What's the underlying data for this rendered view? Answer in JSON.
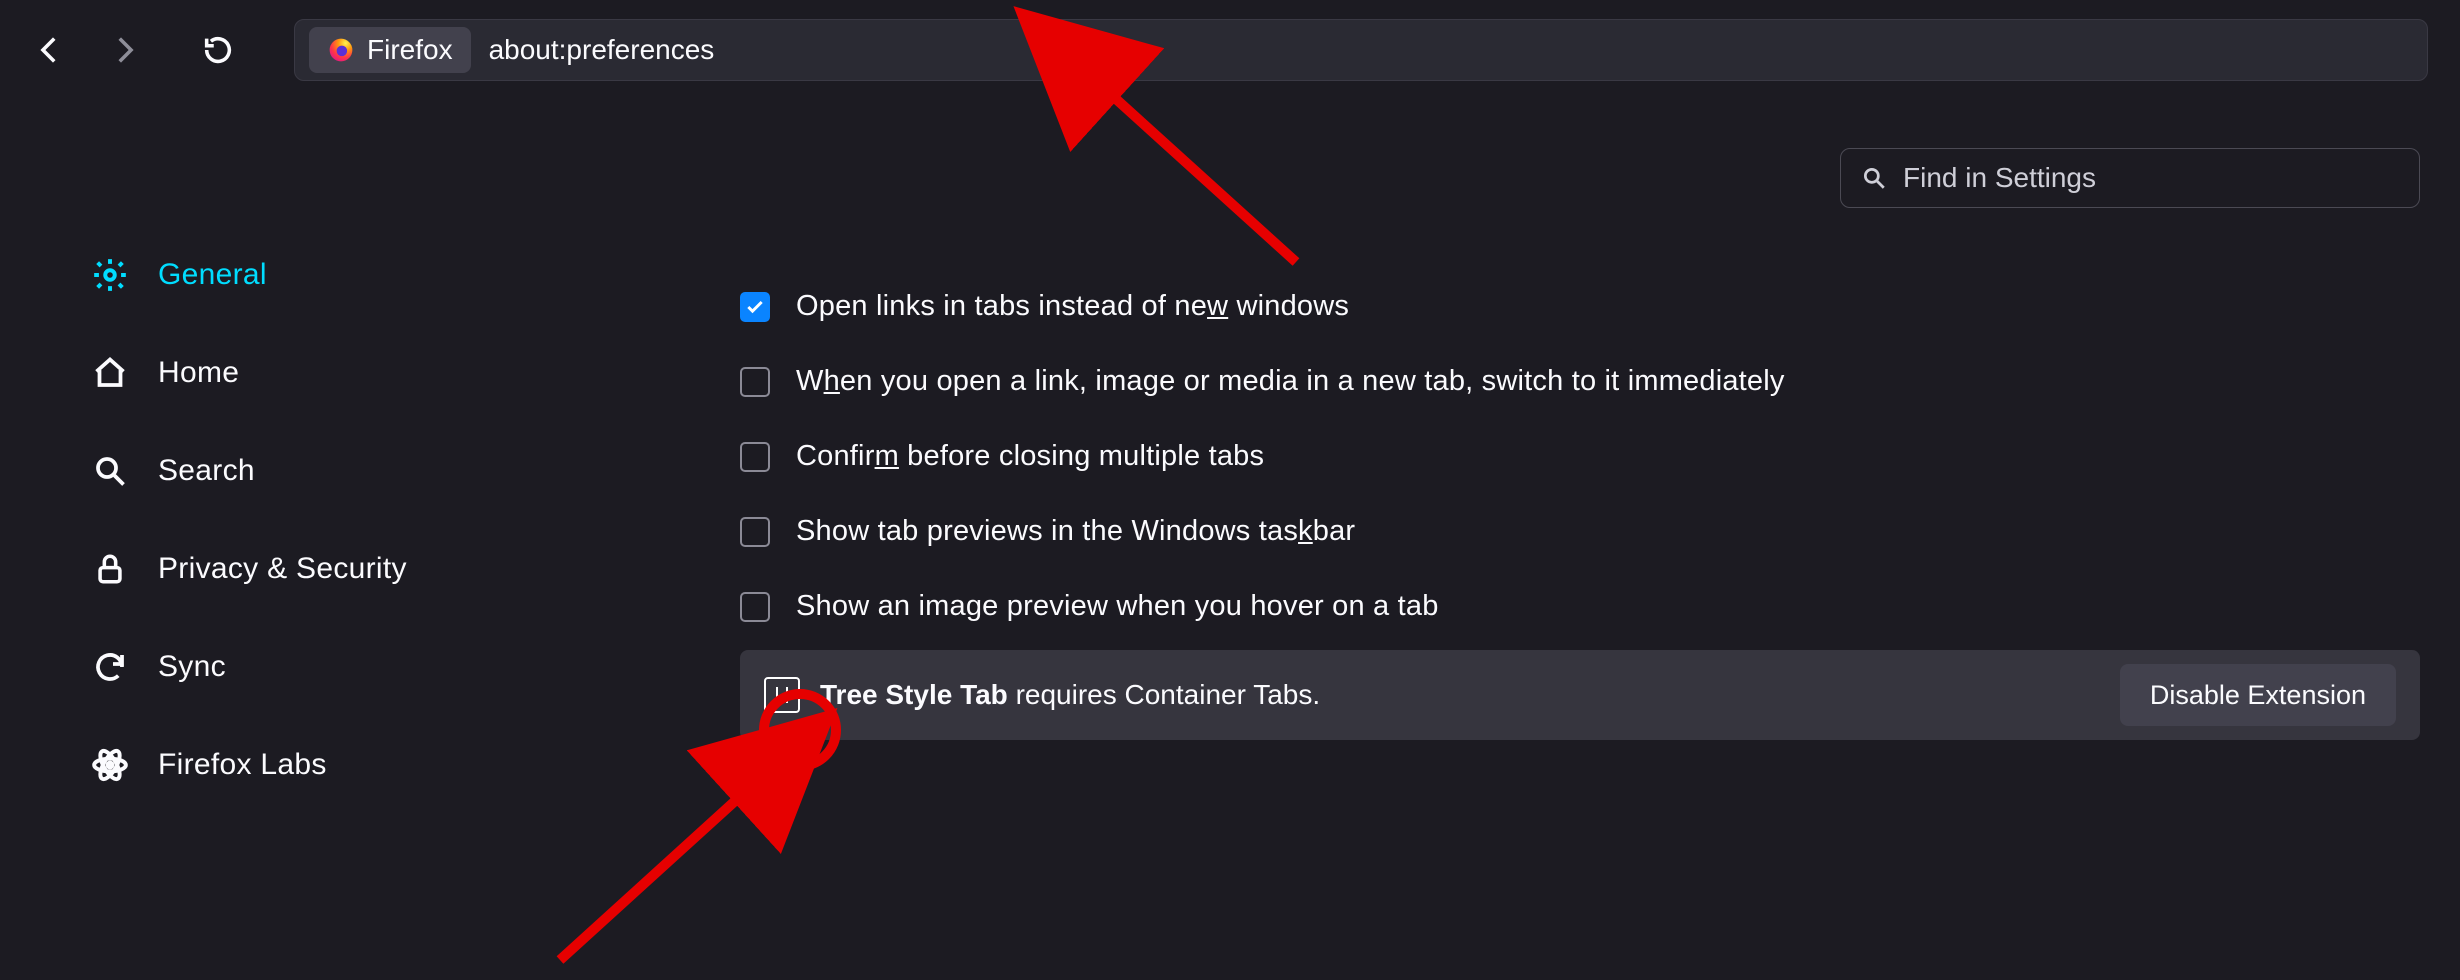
{
  "toolbar": {
    "chip_label": "Firefox",
    "url": "about:preferences"
  },
  "search": {
    "placeholder": "Find in Settings"
  },
  "sidebar": {
    "items": [
      {
        "id": "general",
        "label": "General",
        "active": true
      },
      {
        "id": "home",
        "label": "Home"
      },
      {
        "id": "search",
        "label": "Search"
      },
      {
        "id": "privacy",
        "label": "Privacy & Security"
      },
      {
        "id": "sync",
        "label": "Sync"
      },
      {
        "id": "labs",
        "label": "Firefox Labs"
      }
    ]
  },
  "options": [
    {
      "id": "open-links-tabs",
      "checked": true,
      "label_pre": "Open links in tabs instead of ne",
      "label_ul": "w",
      "label_post": " windows"
    },
    {
      "id": "switch-immediately",
      "checked": false,
      "label_pre": "W",
      "label_ul": "h",
      "label_post": "en you open a link, image or media in a new tab, switch to it immediately"
    },
    {
      "id": "confirm-close",
      "checked": false,
      "label_pre": "Confir",
      "label_ul": "m",
      "label_post": " before closing multiple tabs"
    },
    {
      "id": "taskbar-preview",
      "checked": false,
      "label_pre": "Show tab previews in the Windows tas",
      "label_ul": "k",
      "label_post": "bar"
    },
    {
      "id": "hover-preview",
      "checked": false,
      "label_pre": "Show an image preview when you hover on a tab",
      "label_ul": "",
      "label_post": ""
    }
  ],
  "banner": {
    "ext_name": "Tree Style Tab",
    "suffix": " requires Container Tabs.",
    "button": "Disable Extension"
  }
}
